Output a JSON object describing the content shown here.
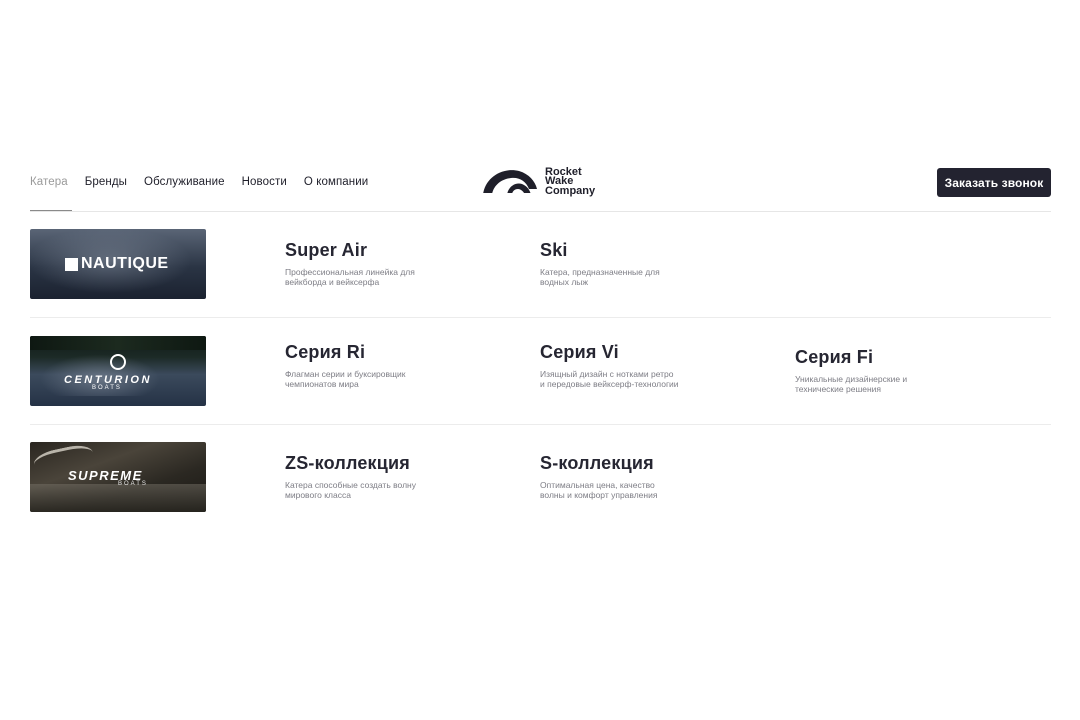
{
  "nav": {
    "items": [
      {
        "label": "Катера",
        "active": true
      },
      {
        "label": "Бренды",
        "active": false
      },
      {
        "label": "Обслуживание",
        "active": false
      },
      {
        "label": "Новости",
        "active": false
      },
      {
        "label": "О компании",
        "active": false
      }
    ]
  },
  "logo": {
    "line1": "Rocket",
    "line2": "Wake",
    "line3": "Company"
  },
  "cta": {
    "label": "Заказать звонок"
  },
  "brands": [
    {
      "logo_text": "NAUTIQUE",
      "series": [
        {
          "title": "Super Air",
          "desc": "Профессиональная линейка для вейкборда и вейксерфа"
        },
        {
          "title": "Ski",
          "desc": "Катера, предназначенные для водных лыж"
        }
      ]
    },
    {
      "logo_text": "CENTURION",
      "logo_sub": "BOATS",
      "series": [
        {
          "title": "Серия Ri",
          "desc": "Флагман серии и буксировщик чемпионатов мира"
        },
        {
          "title": "Серия Vi",
          "desc": "Изящный дизайн с нотками ретро и передовые вейксерф-технологии"
        },
        {
          "title": "Серия Fi",
          "desc": "Уникальные дизайнерские и технические решения"
        }
      ]
    },
    {
      "logo_text": "SUPREME",
      "logo_sub": "BOATS",
      "series": [
        {
          "title": "ZS-коллекция",
          "desc": "Катера способные создать волну мирового класса"
        },
        {
          "title": "S-коллекция",
          "desc": "Оптимальная цена, качество волны и комфорт управления"
        }
      ]
    }
  ],
  "colors": {
    "text_dark": "#1f1f2a",
    "cta_bg": "#232330",
    "muted": "#9a9a9a"
  }
}
